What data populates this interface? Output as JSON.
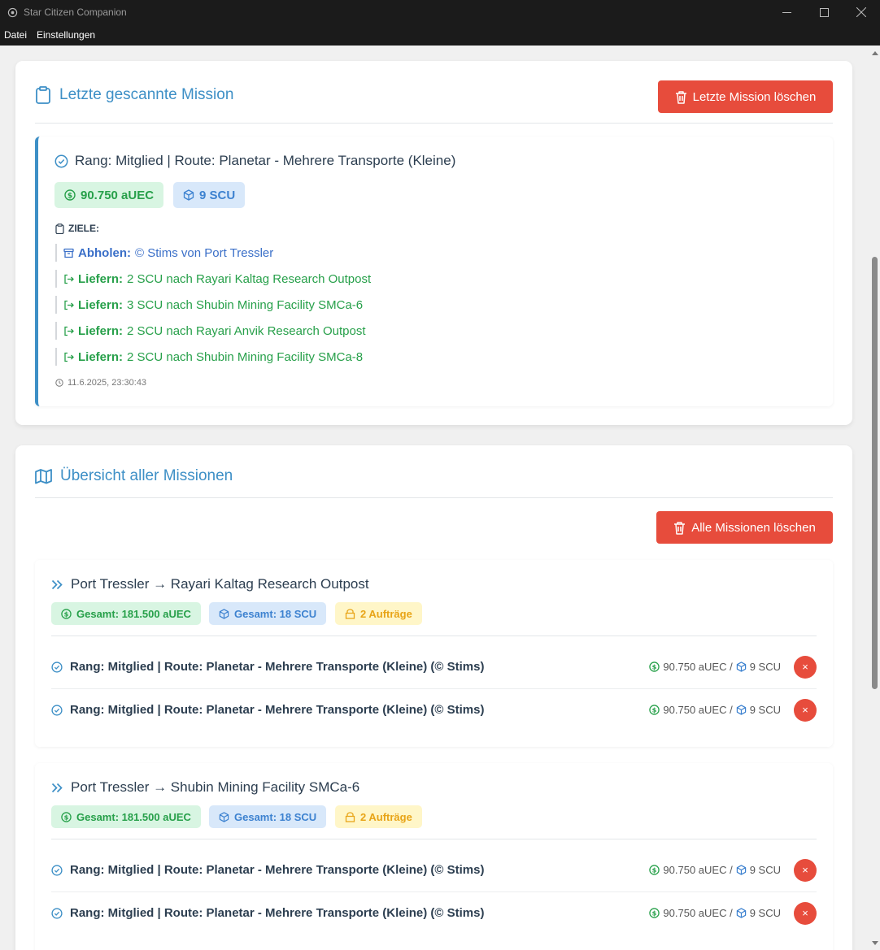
{
  "window": {
    "title": "Star Citizen Companion"
  },
  "menu": [
    "Datei",
    "Einstellungen"
  ],
  "last_mission_section": {
    "title": "Letzte gescannte Mission",
    "delete_label": "Letzte Mission löschen",
    "mission": {
      "title": "Rang: Mitglied | Route: Planetar - Mehrere Transporte (Kleine)",
      "reward": "90.750 aUEC",
      "scu": "9 SCU",
      "objectives_label": "ZIELE:",
      "pickup": {
        "label": "Abholen:",
        "text": "© Stims von Port Tressler"
      },
      "deliveries": [
        {
          "label": "Liefern:",
          "text": "2 SCU nach Rayari Kaltag Research Outpost"
        },
        {
          "label": "Liefern:",
          "text": "3 SCU nach Shubin Mining Facility SMCa-6"
        },
        {
          "label": "Liefern:",
          "text": "2 SCU nach Rayari Anvik Research Outpost"
        },
        {
          "label": "Liefern:",
          "text": "2 SCU nach Shubin Mining Facility SMCa-8"
        }
      ],
      "timestamp": "11.6.2025, 23:30:43"
    }
  },
  "overview_section": {
    "title": "Übersicht aller Missionen",
    "delete_all_label": "Alle Missionen löschen",
    "groups": [
      {
        "route": "Port Tressler → Rayari Kaltag Research Outpost",
        "total_reward": "Gesamt: 181.500 aUEC",
        "total_scu": "Gesamt: 18 SCU",
        "orders": "2 Aufträge",
        "missions": [
          {
            "name": "Rang: Mitglied | Route: Planetar - Mehrere Transporte (Kleine) (© Stims)",
            "reward": "90.750 aUEC /",
            "scu": "9 SCU",
            "delete": "×"
          },
          {
            "name": "Rang: Mitglied | Route: Planetar - Mehrere Transporte (Kleine) (© Stims)",
            "reward": "90.750 aUEC /",
            "scu": "9 SCU",
            "delete": "×"
          }
        ]
      },
      {
        "route": "Port Tressler → Shubin Mining Facility SMCa-6",
        "total_reward": "Gesamt: 181.500 aUEC",
        "total_scu": "Gesamt: 18 SCU",
        "orders": "2 Aufträge",
        "missions": [
          {
            "name": "Rang: Mitglied | Route: Planetar - Mehrere Transporte (Kleine) (© Stims)",
            "reward": "90.750 aUEC /",
            "scu": "9 SCU",
            "delete": "×"
          },
          {
            "name": "Rang: Mitglied | Route: Planetar - Mehrere Transporte (Kleine) (© Stims)",
            "reward": "90.750 aUEC /",
            "scu": "9 SCU",
            "delete": "×"
          }
        ]
      }
    ]
  },
  "colors": {
    "accent": "#3d8fc6",
    "danger": "#e74c3c",
    "success": "#27a04a",
    "info": "#3d82d0",
    "warning": "#e8a417"
  },
  "icons": [
    "clipboard-icon",
    "trash-icon",
    "check-circle-icon",
    "dollar-icon",
    "cube-icon",
    "archive-icon",
    "exit-icon",
    "clock-icon",
    "map-icon",
    "double-chevron-icon",
    "package-icon"
  ]
}
